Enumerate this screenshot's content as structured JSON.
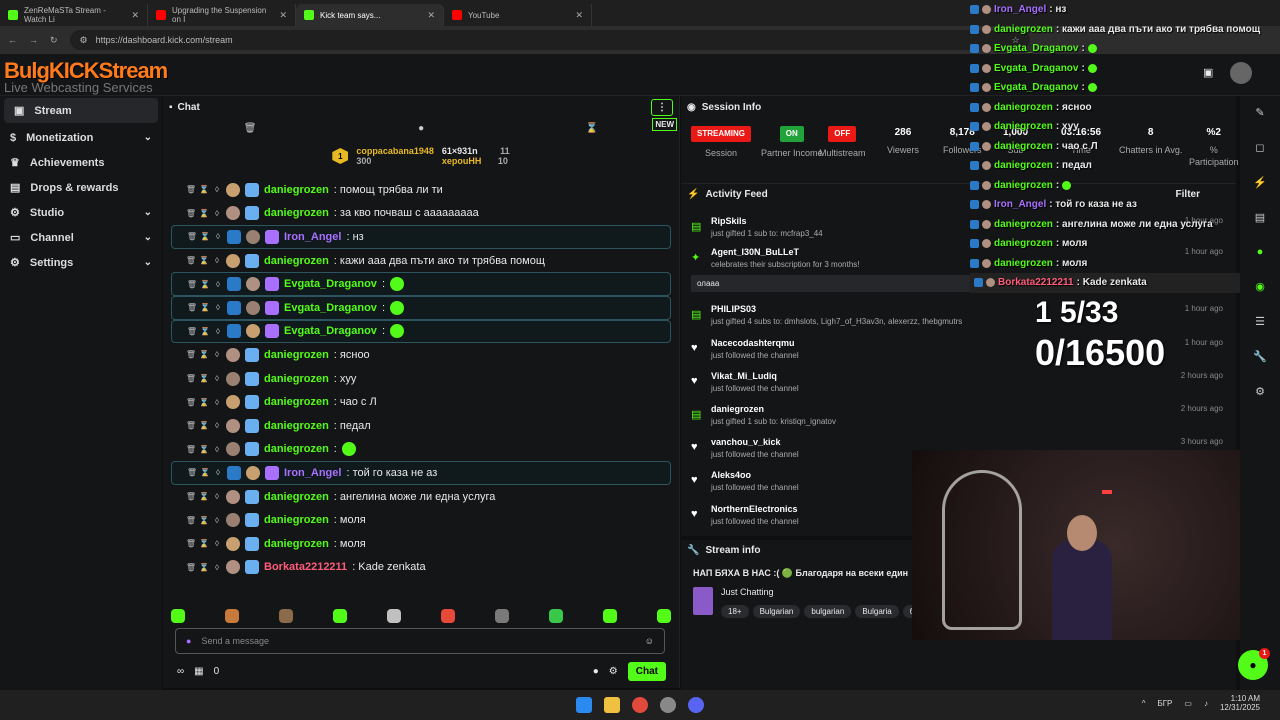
{
  "browser": {
    "tabs": [
      {
        "label": "ZenReMaSTa Stream - Watch Li",
        "color": "#53fc18"
      },
      {
        "label": "Upgrading the Suspension on I",
        "color": "#ff0000"
      },
      {
        "label": "Kick team says...",
        "color": "#53fc18"
      },
      {
        "label": "YouTube",
        "color": "#ff0000"
      }
    ],
    "url": "https://dashboard.kick.com/stream"
  },
  "logo": {
    "line1": "BulgKICKStream",
    "line2": "Live Webcasting Services"
  },
  "sidebar": {
    "items": [
      {
        "label": "Stream",
        "icon": "stream-icon"
      },
      {
        "label": "Monetization",
        "icon": "dollar-icon"
      },
      {
        "label": "Achievements",
        "icon": "trophy-icon"
      },
      {
        "label": "Drops & rewards",
        "icon": "gift-icon"
      },
      {
        "label": "Studio",
        "icon": "studio-icon"
      },
      {
        "label": "Channel",
        "icon": "channel-icon"
      },
      {
        "label": "Settings",
        "icon": "gear-icon"
      }
    ]
  },
  "chat": {
    "title": "Chat",
    "new_label": "NEW",
    "pinned": {
      "user1": "coppacabana1948",
      "amount1": "300",
      "user2": "61×931n",
      "count2": "11",
      "user3": "xepouHH",
      "count3": "10"
    },
    "messages": [
      {
        "user": "daniegrozen",
        "text": ": помощ трябва ли ти",
        "color": "#53fc18",
        "hl": false
      },
      {
        "user": "daniegrozen",
        "text": ": за кво почваш с ааааааааа",
        "color": "#53fc18",
        "hl": false
      },
      {
        "user": "Iron_Angel",
        "text": ": нз",
        "color": "#a970ff",
        "hl": true
      },
      {
        "user": "daniegrozen",
        "text": ": кажи ааа два пъти ако ти трябва помощ",
        "color": "#53fc18",
        "hl": false
      },
      {
        "user": "Evgata_Draganov",
        "text": ":",
        "color": "#53fc18",
        "hl": true
      },
      {
        "user": "Evgata_Draganov",
        "text": ":",
        "color": "#53fc18",
        "hl": true
      },
      {
        "user": "Evgata_Draganov",
        "text": ":",
        "color": "#53fc18",
        "hl": true
      },
      {
        "user": "daniegrozen",
        "text": ": ясноо",
        "color": "#53fc18",
        "hl": false
      },
      {
        "user": "daniegrozen",
        "text": ": хуу",
        "color": "#53fc18",
        "hl": false
      },
      {
        "user": "daniegrozen",
        "text": ": чао с Л",
        "color": "#53fc18",
        "hl": false
      },
      {
        "user": "daniegrozen",
        "text": ": педал",
        "color": "#53fc18",
        "hl": false
      },
      {
        "user": "daniegrozen",
        "text": ":",
        "color": "#53fc18",
        "hl": false
      },
      {
        "user": "Iron_Angel",
        "text": ": той го каза не аз",
        "color": "#a970ff",
        "hl": true
      },
      {
        "user": "daniegrozen",
        "text": ": ангелина може ли една услуга",
        "color": "#53fc18",
        "hl": false
      },
      {
        "user": "daniegrozen",
        "text": ": моля",
        "color": "#53fc18",
        "hl": false
      },
      {
        "user": "daniegrozen",
        "text": ": моля",
        "color": "#53fc18",
        "hl": false
      },
      {
        "user": "Borkata2212211",
        "text": ": Kade zenkata",
        "color": "#ff5c7a",
        "hl": false
      }
    ],
    "input_placeholder": "Send a message",
    "footer_count": "0",
    "send_label": "Chat"
  },
  "session": {
    "title": "Session Info",
    "stats": [
      {
        "value": "STREAMING",
        "label": "Session",
        "pill": "#e91916"
      },
      {
        "value": "ON",
        "label": "Partner Income",
        "pill": "#22a33a"
      },
      {
        "value": "OFF",
        "label": "Multistream",
        "pill": "#e91916"
      },
      {
        "value": "286",
        "label": "Viewers"
      },
      {
        "value": "8,178",
        "label": "Followers"
      },
      {
        "value": "1,000",
        "label": "Sub"
      },
      {
        "value": "03:16:56",
        "label": "Time"
      },
      {
        "value": "8",
        "label": "Chatters in Avg."
      },
      {
        "value": "%2",
        "label": "% Participation"
      }
    ]
  },
  "activity": {
    "title": "Activity Feed",
    "filter_label": "Filter",
    "items": [
      {
        "name": "RipSkils",
        "desc": "just gifted 1 sub to: mcfrap3_44",
        "time": "1 hour ago",
        "icon": "gift-icon"
      },
      {
        "name": "Agent_I30N_BuLLeT",
        "desc": "celebrates their subscription for 3 months!",
        "time": "1 hour ago",
        "icon": "star-icon",
        "note": "олааа"
      },
      {
        "name": "PHILIPS03",
        "desc": "just gifted 4 subs to: dmhslots, Ligh7_of_H3av3n, alexerzz, thebgmutrs",
        "time": "1 hour ago",
        "icon": "gift-icon"
      },
      {
        "name": "Nacecodashterqmu",
        "desc": "just followed the channel",
        "time": "1 hour ago",
        "icon": "heart-icon"
      },
      {
        "name": "Vikat_Mi_Ludiq",
        "desc": "just followed the channel",
        "time": "2 hours ago",
        "icon": "heart-icon"
      },
      {
        "name": "daniegrozen",
        "desc": "just gifted 1 sub to: kristiqn_ignatov",
        "time": "2 hours ago",
        "icon": "gift-icon"
      },
      {
        "name": "vanchou_v_kick",
        "desc": "just followed the channel",
        "time": "3 hours ago",
        "icon": "heart-icon"
      },
      {
        "name": "Aleks4oo",
        "desc": "just followed the channel",
        "time": "",
        "icon": "heart-icon"
      },
      {
        "name": "NorthernElectronics",
        "desc": "just followed the channel",
        "time": "",
        "icon": "heart-icon"
      }
    ]
  },
  "stream_info": {
    "title": "Stream info",
    "stream_title": "НАП БЯХА В НАС :( 🟢 Благодаря на всеки един",
    "category": "Just Chatting",
    "tags": [
      "18+",
      "Bulgarian",
      "bulgarian",
      "Bulgaria",
      "бълг"
    ]
  },
  "overlay": {
    "lines": [
      {
        "user": "Iron_Angel",
        "text": ": нз",
        "color": "#a970ff"
      },
      {
        "user": "daniegrozen",
        "text": ": кажи ааа два пъти ако ти трябва помощ",
        "color": "#53fc18"
      },
      {
        "user": "Evgata_Draganov",
        "text": ":",
        "color": "#53fc18"
      },
      {
        "user": "Evgata_Draganov",
        "text": ":",
        "color": "#53fc18"
      },
      {
        "user": "Evgata_Draganov",
        "text": ":",
        "color": "#53fc18"
      },
      {
        "user": "daniegrozen",
        "text": ": ясноо",
        "color": "#53fc18"
      },
      {
        "user": "daniegrozen",
        "text": ": хуу",
        "color": "#53fc18"
      },
      {
        "user": "daniegrozen",
        "text": ": чао с Л",
        "color": "#53fc18"
      },
      {
        "user": "daniegrozen",
        "text": ": педал",
        "color": "#53fc18"
      },
      {
        "user": "daniegrozen",
        "text": ":",
        "color": "#53fc18"
      },
      {
        "user": "Iron_Angel",
        "text": ": той го каза не аз",
        "color": "#a970ff"
      },
      {
        "user": "daniegrozen",
        "text": ": ангелина може ли една услуга",
        "color": "#53fc18"
      },
      {
        "user": "daniegrozen",
        "text": ": моля",
        "color": "#53fc18"
      },
      {
        "user": "daniegrozen",
        "text": ": моля",
        "color": "#53fc18"
      },
      {
        "user": "Borkata2212211",
        "text": ": Kade zenkata",
        "color": "#ff5c7a"
      }
    ],
    "goal1": "1 5/33",
    "goal2": "0/16500"
  },
  "taskbar": {
    "lang": "БГР",
    "time": "1:10 AM",
    "date": "12/31/2025",
    "badge": "1"
  }
}
